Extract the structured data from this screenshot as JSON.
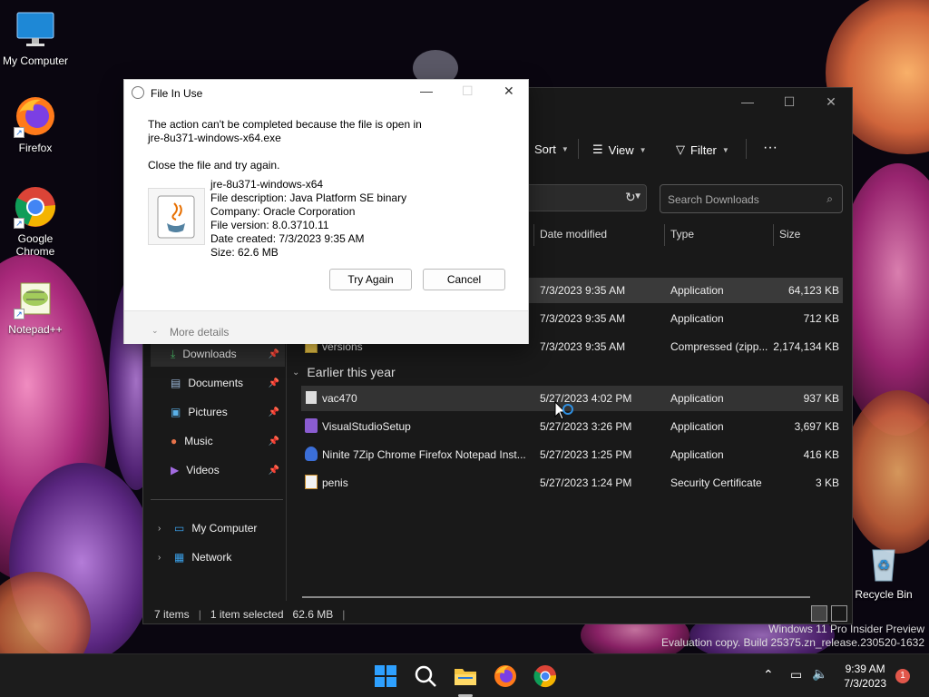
{
  "desktop": {
    "icons": [
      {
        "label": "My Computer",
        "icon": "monitor-icon"
      },
      {
        "label": "Firefox",
        "icon": "firefox-icon"
      },
      {
        "label": "Google Chrome",
        "icon": "chrome-icon"
      },
      {
        "label": "Notepad++",
        "icon": "notepadpp-icon"
      },
      {
        "label": "Recycle Bin",
        "icon": "recycle-bin-icon"
      }
    ],
    "watermark_line1": "Windows 11 Pro Insider Preview",
    "watermark_line2": "Evaluation copy. Build 25375.zn_release.230520-1632"
  },
  "explorer": {
    "toolbar": {
      "sort": "Sort",
      "view": "View",
      "filter": "Filter",
      "more": "···"
    },
    "search_placeholder": "Search Downloads",
    "columns": {
      "date": "Date modified",
      "type": "Type",
      "size": "Size"
    },
    "files_today": [
      {
        "name": "",
        "date": "7/3/2023 9:35 AM",
        "type": "Application",
        "size": "64,123 KB"
      },
      {
        "name": "",
        "date": "7/3/2023 9:35 AM",
        "type": "Application",
        "size": "712 KB"
      },
      {
        "name": "versions",
        "date": "7/3/2023 9:35 AM",
        "type": "Compressed (zipp...",
        "size": "2,174,134 KB"
      }
    ],
    "group_earlier": "Earlier this year",
    "files_earlier": [
      {
        "name": "vac470",
        "date": "5/27/2023 4:02 PM",
        "type": "Application",
        "size": "937 KB"
      },
      {
        "name": "VisualStudioSetup",
        "date": "5/27/2023 3:26 PM",
        "type": "Application",
        "size": "3,697 KB"
      },
      {
        "name": "Ninite 7Zip Chrome Firefox Notepad Inst...",
        "date": "5/27/2023 1:25 PM",
        "type": "Application",
        "size": "416 KB"
      },
      {
        "name": "penis",
        "date": "5/27/2023 1:24 PM",
        "type": "Security Certificate",
        "size": "3 KB"
      }
    ],
    "nav": {
      "downloads": "Downloads",
      "documents": "Documents",
      "pictures": "Pictures",
      "music": "Music",
      "videos": "Videos",
      "my_computer": "My Computer",
      "network": "Network"
    },
    "status": {
      "items": "7 items",
      "selected": "1 item selected",
      "size": "62.6 MB"
    }
  },
  "dialog": {
    "title": "File In Use",
    "message_line1": "The action can't be completed because the file is open in",
    "message_line2": "jre-8u371-windows-x64.exe",
    "message_line3": "Close the file and try again.",
    "file_name": "jre-8u371-windows-x64",
    "file_description": "File description: Java Platform SE binary",
    "company": "Company: Oracle Corporation",
    "file_version": "File version: 8.0.3710.11",
    "date_created": "Date created: 7/3/2023 9:35 AM",
    "size": "Size: 62.6 MB",
    "try_again": "Try Again",
    "cancel": "Cancel",
    "more_details": "More details"
  },
  "taskbar": {
    "time": "9:39 AM",
    "date": "7/3/2023",
    "notifications": "1"
  }
}
